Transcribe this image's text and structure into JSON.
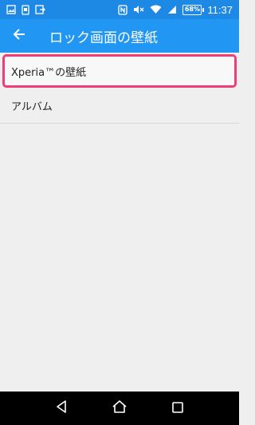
{
  "status_bar": {
    "battery": "68%",
    "time": "11:37"
  },
  "app_bar": {
    "title": "ロック画面の壁紙"
  },
  "list": {
    "items": [
      {
        "label": "Xperia™の壁紙"
      },
      {
        "label": "アルバム"
      }
    ]
  },
  "colors": {
    "status_bar": "#1e88e5",
    "app_bar": "#2196f3",
    "highlight_border": "#f23c7a",
    "background": "#efefef"
  }
}
